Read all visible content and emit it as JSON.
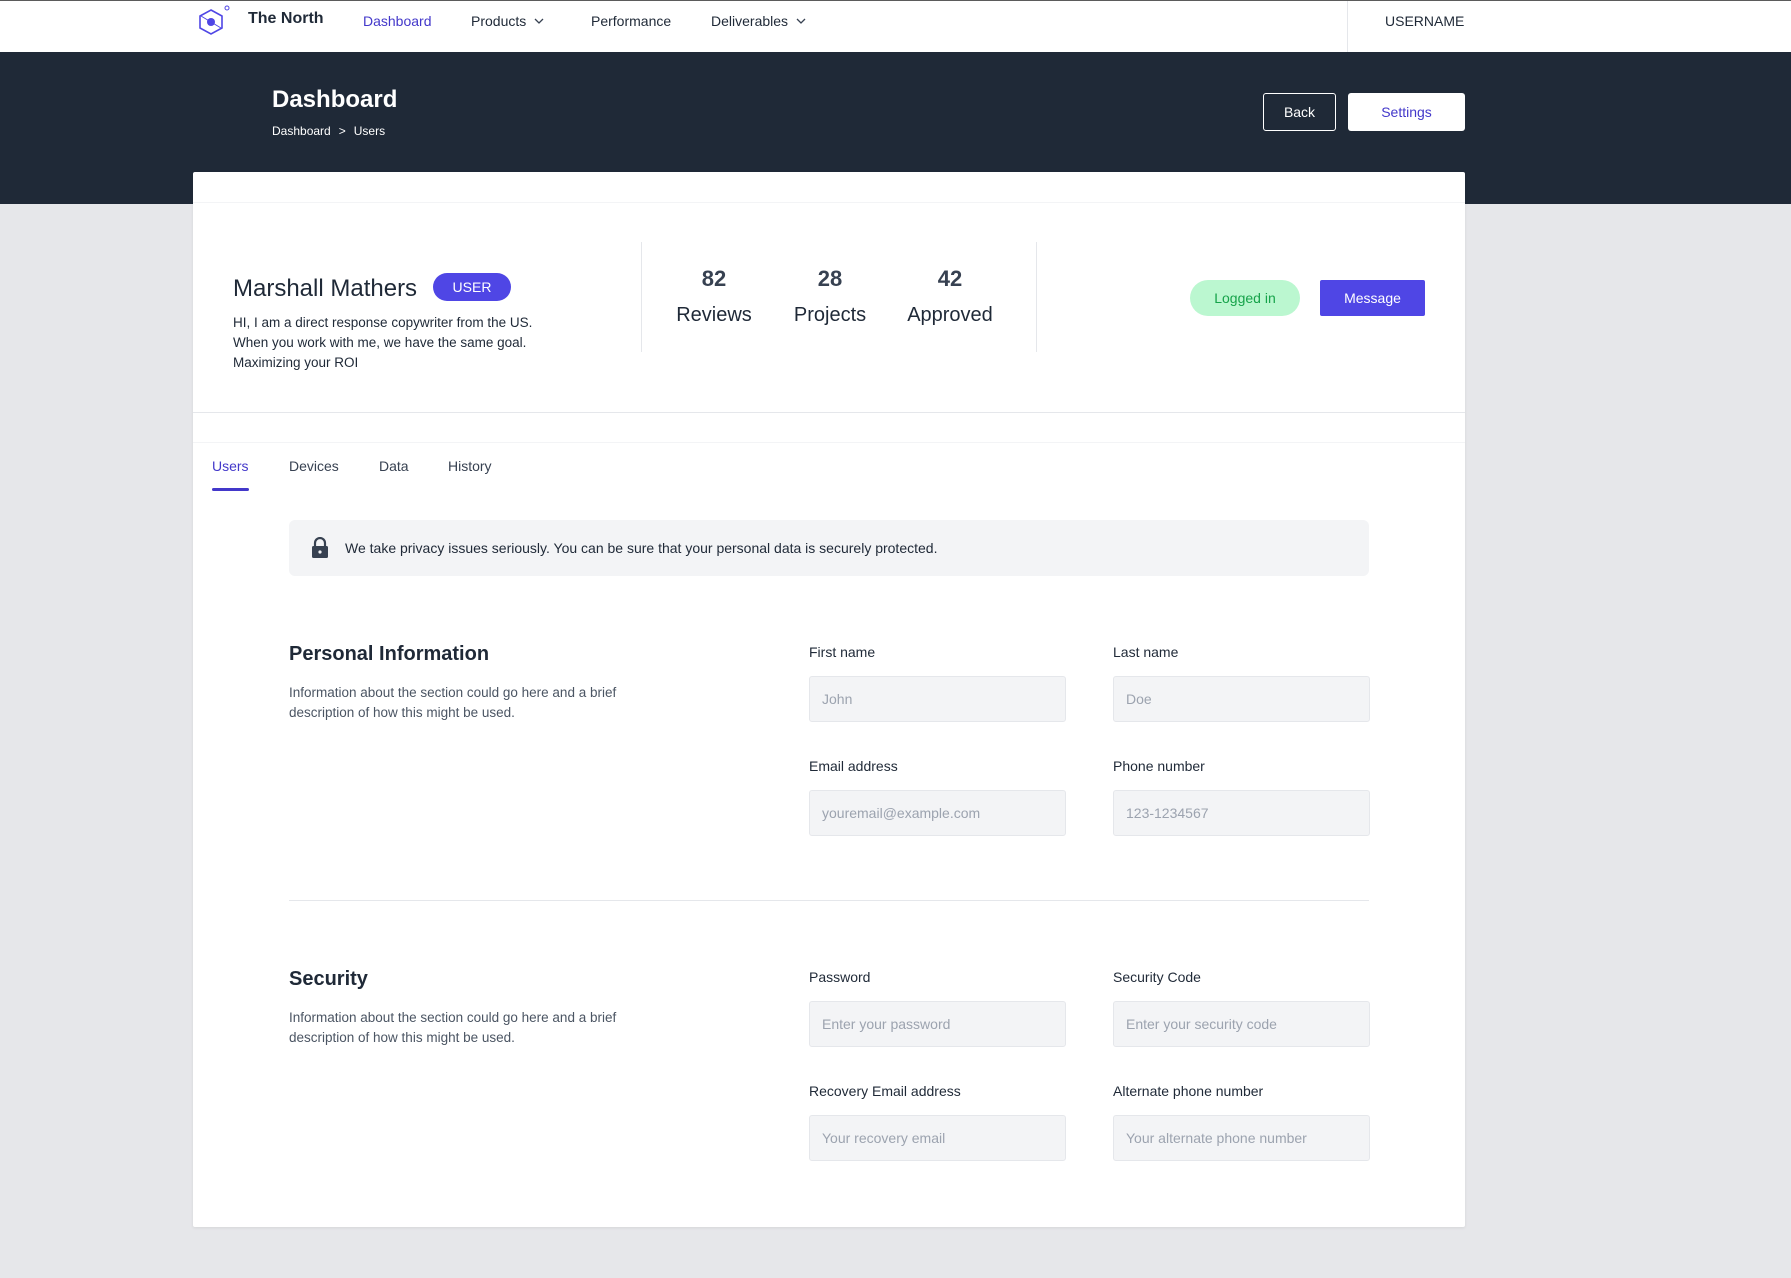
{
  "nav": {
    "brand": "The North",
    "items": [
      {
        "label": "Dashboard"
      },
      {
        "label": "Products"
      },
      {
        "label": "Performance"
      },
      {
        "label": "Deliverables"
      }
    ],
    "username": "USERNAME"
  },
  "header": {
    "title": "Dashboard",
    "breadcrumb": [
      "Dashboard",
      ">",
      "Users"
    ],
    "back_label": "Back",
    "settings_label": "Settings"
  },
  "profile": {
    "name": "Marshall Mathers",
    "role_badge": "USER",
    "bio": "HI, I am a direct response copywriter from the US. When you work with me, we have the same goal. Maximizing your ROI",
    "stats": [
      {
        "value": "82",
        "label": "Reviews"
      },
      {
        "value": "28",
        "label": "Projects"
      },
      {
        "value": "42",
        "label": "Approved"
      }
    ],
    "status": "Logged in",
    "message_label": "Message"
  },
  "tabs": [
    {
      "label": "Users"
    },
    {
      "label": "Devices"
    },
    {
      "label": "Data"
    },
    {
      "label": "History"
    }
  ],
  "notice": "We take privacy issues seriously. You can be sure that your personal data is securely protected.",
  "personal": {
    "title": "Personal Information",
    "description": "Information about the section could go here and a brief description of how this might be used.",
    "first_name": {
      "label": "First name",
      "placeholder": "John"
    },
    "last_name": {
      "label": "Last name",
      "placeholder": "Doe"
    },
    "email": {
      "label": "Email address",
      "placeholder": "youremail@example.com"
    },
    "phone": {
      "label": "Phone number",
      "placeholder": "123-1234567"
    }
  },
  "security": {
    "title": "Security",
    "description": "Information about the section could go here and a brief description of how this might be used.",
    "password": {
      "label": "Password",
      "placeholder": "Enter your password"
    },
    "security_code": {
      "label": "Security Code",
      "placeholder": "Enter your security code"
    },
    "recovery_email": {
      "label": "Recovery Email address",
      "placeholder": "Your recovery email"
    },
    "alt_phone": {
      "label": "Alternate phone number",
      "placeholder": "Your alternate phone number"
    }
  },
  "colors": {
    "accent": "#4f46e5",
    "header_bg": "#1f2937",
    "status_bg": "#bbf7d0",
    "status_text": "#16a34a"
  }
}
